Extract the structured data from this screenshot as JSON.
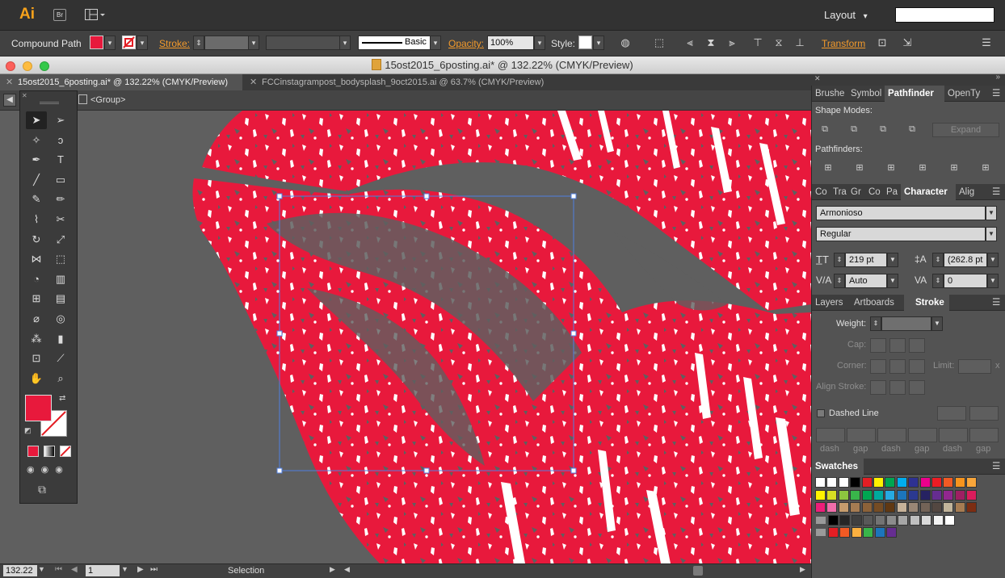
{
  "appbar": {
    "logo": "Ai",
    "bridge": "Br",
    "workspace": "Layout",
    "workspace_arrow": "▾",
    "search_placeholder": ""
  },
  "control": {
    "selection_type": "Compound Path",
    "stroke_label": "Stroke:",
    "brush_label": "Basic",
    "opacity_label": "Opacity:",
    "opacity_value": "100%",
    "style_label": "Style:",
    "transform_label": "Transform",
    "fill_color": "#e8193c"
  },
  "window": {
    "title": "15ost2015_6posting.ai* @ 132.22% (CMYK/Preview)"
  },
  "tabs": [
    {
      "label": "15ost2015_6posting.ai* @ 132.22% (CMYK/Preview)",
      "active": true
    },
    {
      "label": "FCCinstagrampost_bodysplash_9oct2015.ai @ 63.7% (CMYK/Preview)",
      "active": false
    }
  ],
  "isolation": {
    "label": "<Group>"
  },
  "tools": {
    "icons": [
      "selection-icon",
      "direct-selection-icon",
      "magic-wand-icon",
      "lasso-icon",
      "pen-icon",
      "type-icon",
      "line-segment-icon",
      "rectangle-icon",
      "paintbrush-icon",
      "pencil-icon",
      "blob-brush-icon",
      "scissors-icon",
      "rotate-icon",
      "scale-icon",
      "width-icon",
      "free-transform-icon",
      "shape-builder-icon",
      "perspective-grid-icon",
      "mesh-icon",
      "gradient-icon",
      "eyedropper-icon",
      "blend-icon",
      "symbol-sprayer-icon",
      "column-graph-icon",
      "artboard-icon",
      "slice-icon",
      "hand-icon",
      "zoom-icon"
    ],
    "fill_color": "#e8193c"
  },
  "panels": {
    "group1_tabs": [
      "Brushe",
      "Symbol",
      "Pathfinder",
      "OpenTy"
    ],
    "shape_modes_label": "Shape Modes:",
    "expand_label": "Expand",
    "pathfinders_label": "Pathfinders:",
    "group2_tabs": [
      "Co",
      "Tra",
      "Gr",
      "Co",
      "Pa",
      "Character",
      "Alig"
    ],
    "font_family": "Armonioso",
    "font_style": "Regular",
    "font_size": "219 pt",
    "leading": "(262.8 pt",
    "kerning": "Auto",
    "tracking": "0",
    "group3_tabs": [
      "Layers",
      "Artboards",
      "Stroke"
    ],
    "weight_label": "Weight:",
    "cap_label": "Cap:",
    "corner_label": "Corner:",
    "limit_label": "Limit:",
    "limit_unit": "x",
    "align_stroke_label": "Align Stroke:",
    "dashed_line_label": "Dashed Line",
    "dash_labels": [
      "dash",
      "gap",
      "dash",
      "gap",
      "dash",
      "gap"
    ],
    "swatches_label": "Swatches",
    "swatch_rows": [
      [
        "#ffffff",
        "#ffffff",
        "#ffffff",
        "#000000",
        "#e31e24",
        "#fff200",
        "#00a651",
        "#00aeef",
        "#2e3192",
        "#ec008c",
        "#ed1c24",
        "#f15a24",
        "#f7941d",
        "#f9a63a"
      ],
      [
        "#fff200",
        "#d7df23",
        "#8dc63f",
        "#39b54a",
        "#00a651",
        "#00a99d",
        "#27aae1",
        "#1c75bc",
        "#2b3990",
        "#262262",
        "#662d91",
        "#92278f",
        "#9e1f63",
        "#da1c5c"
      ],
      [
        "#ed1e79",
        "#f06eaa",
        "#c69c6d",
        "#a67c52",
        "#8c6239",
        "#754c24",
        "#603813",
        "#c7b299",
        "#998675",
        "#736357",
        "#534741",
        "#c2b59b",
        "#a67c52",
        "#7c2d12"
      ],
      [
        "#000000",
        "#262626",
        "#404040",
        "#595959",
        "#737373",
        "#8c8c8c",
        "#a6a6a6",
        "#bfbfbf",
        "#d9d9d9",
        "#f2f2f2",
        "#ffffff"
      ],
      [
        "#e31e24",
        "#f15a24",
        "#fbb040",
        "#39b54a",
        "#1c75bc",
        "#662d91"
      ]
    ]
  },
  "status": {
    "zoom": "132.22",
    "artboard": "1",
    "tool": "Selection"
  }
}
